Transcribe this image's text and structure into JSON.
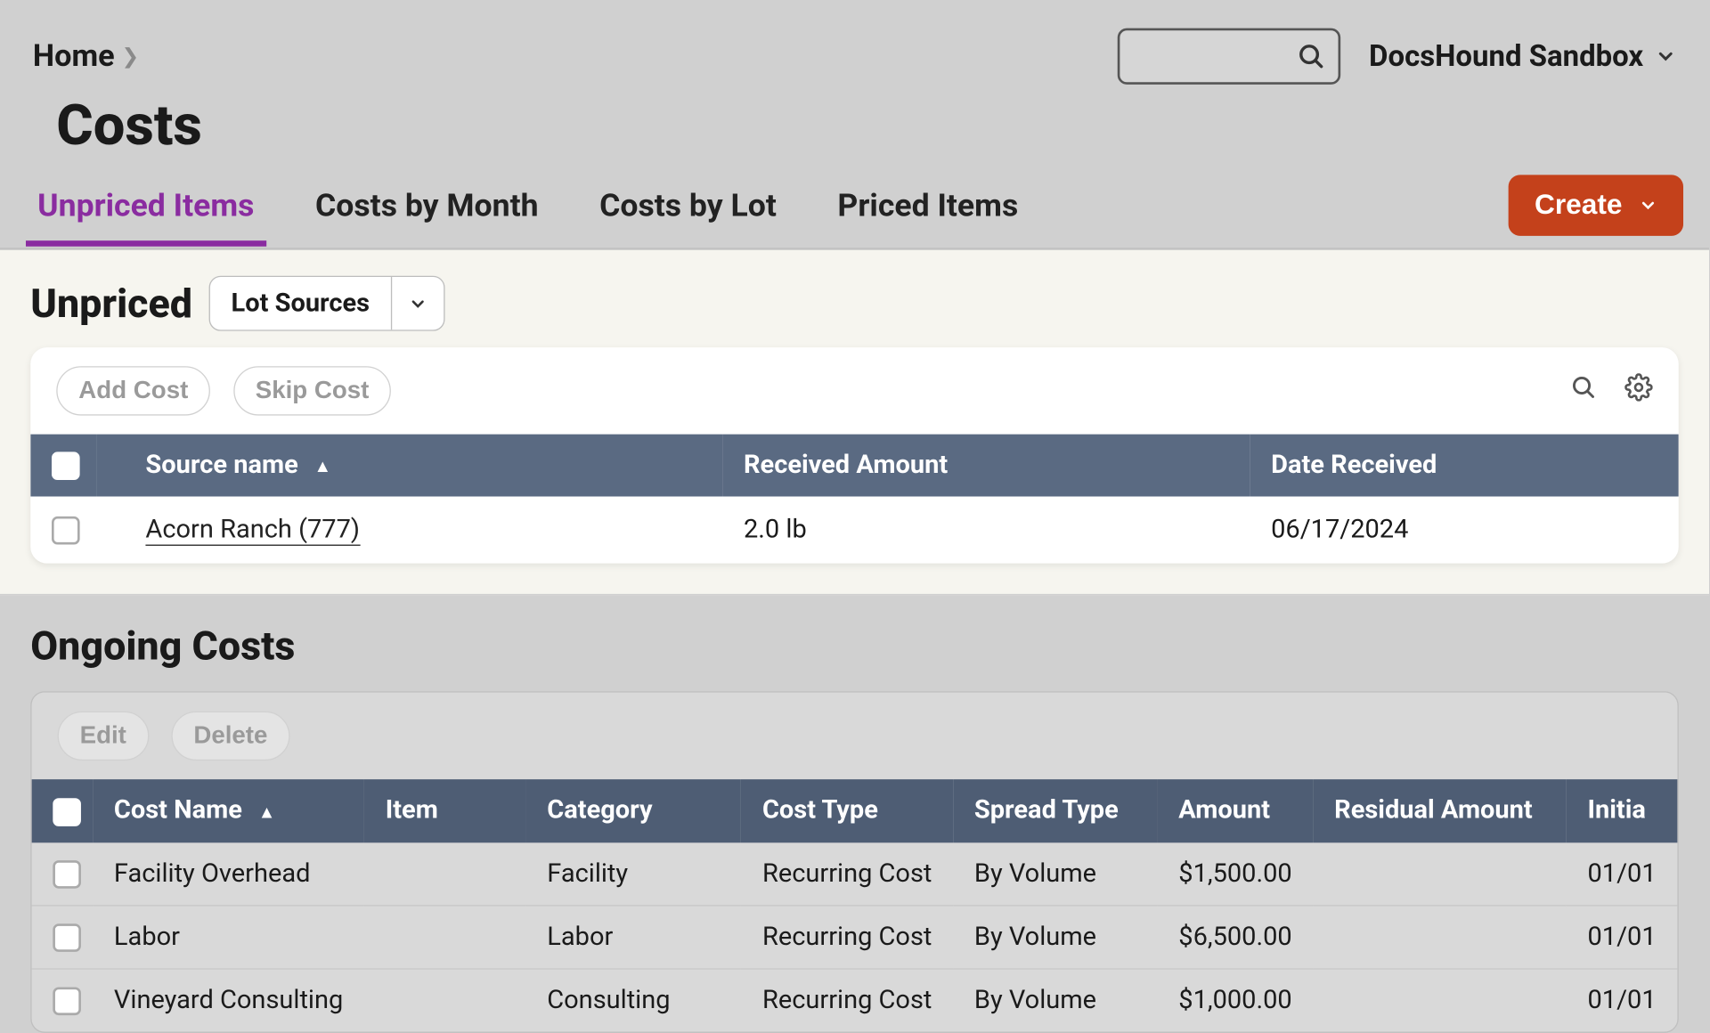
{
  "breadcrumb": {
    "home": "Home"
  },
  "page_title": "Costs",
  "workspace": "DocsHound Sandbox",
  "tabs": [
    {
      "label": "Unpriced Items",
      "active": true
    },
    {
      "label": "Costs by Month",
      "active": false
    },
    {
      "label": "Costs by Lot",
      "active": false
    },
    {
      "label": "Priced Items",
      "active": false
    }
  ],
  "create_label": "Create",
  "unpriced": {
    "heading": "Unpriced",
    "dropdown_label": "Lot Sources",
    "buttons": {
      "add": "Add Cost",
      "skip": "Skip Cost"
    },
    "columns": {
      "source": "Source name",
      "received_amount": "Received Amount",
      "date_received": "Date Received"
    },
    "rows": [
      {
        "source": "Acorn Ranch (777)",
        "received_amount": "2.0 lb",
        "date_received": "06/17/2024"
      }
    ]
  },
  "ongoing": {
    "heading": "Ongoing Costs",
    "buttons": {
      "edit": "Edit",
      "delete": "Delete"
    },
    "columns": {
      "cost_name": "Cost Name",
      "item": "Item",
      "category": "Category",
      "cost_type": "Cost Type",
      "spread_type": "Spread Type",
      "amount": "Amount",
      "residual_amount": "Residual Amount",
      "initial": "Initia"
    },
    "rows": [
      {
        "cost_name": "Facility Overhead",
        "item": "",
        "category": "Facility",
        "cost_type": "Recurring Cost",
        "spread_type": "By Volume",
        "amount": "$1,500.00",
        "residual_amount": "",
        "initial": "01/01"
      },
      {
        "cost_name": "Labor",
        "item": "",
        "category": "Labor",
        "cost_type": "Recurring Cost",
        "spread_type": "By Volume",
        "amount": "$6,500.00",
        "residual_amount": "",
        "initial": "01/01"
      },
      {
        "cost_name": "Vineyard Consulting",
        "item": "",
        "category": "Consulting",
        "cost_type": "Recurring Cost",
        "spread_type": "By Volume",
        "amount": "$1,000.00",
        "residual_amount": "",
        "initial": "01/01"
      }
    ]
  }
}
